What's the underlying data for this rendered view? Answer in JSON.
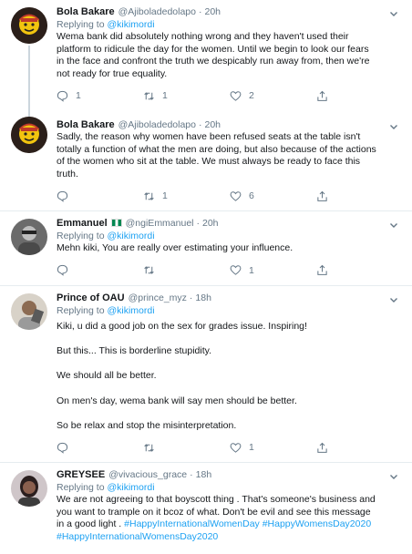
{
  "tweets": [
    {
      "name": "Bola Bakare",
      "handle": "@Ajiboladedolapo",
      "time": "20h",
      "reply_prefix": "Replying to",
      "reply_to": "@kikimordi",
      "lines": [
        "Wema bank did absolutely nothing wrong and they haven't used their",
        "platform to ridicule the day for the women. Until we begin to look our fears",
        "in the face and confront the truth we despicably run away from, then we're",
        "not ready for true equality."
      ],
      "replies": "1",
      "retweets": "1",
      "likes": "2"
    },
    {
      "name": "Bola Bakare",
      "handle": "@Ajiboladedolapo",
      "time": "20h",
      "lines": [
        "Sadly, the reason why women have been refused seats at the table isn't",
        "totally a function of what the men are doing, but also because of the actions",
        "of the women who sit at the table. We must always be ready to face this",
        "truth."
      ],
      "replies": "",
      "retweets": "1",
      "likes": "6"
    },
    {
      "name": "Emmanuel",
      "handle": "@ngiEmmanuel",
      "time": "20h",
      "reply_prefix": "Replying to",
      "reply_to": "@kikimordi",
      "lines": [
        "Mehn kiki, You are really over estimating your influence."
      ],
      "replies": "",
      "retweets": "",
      "likes": "1"
    },
    {
      "name": "Prince of OAU",
      "handle": "@prince_myz",
      "time": "18h",
      "reply_prefix": "Replying to",
      "reply_to": "@kikimordi",
      "paragraphs": [
        "Kiki, u did a good job on the sex for grades issue. Inspiring!",
        "But this... This is borderline stupidity.",
        "We should all be better.",
        "On men's day, wema bank will say men should be better.",
        "So be relax and stop the misinterpretation."
      ],
      "replies": "",
      "retweets": "",
      "likes": "1"
    },
    {
      "name": "GREYSEE",
      "handle": "@vivacious_grace",
      "time": "18h",
      "reply_prefix": "Replying to",
      "reply_to": "@kikimordi",
      "lines": [
        "We are not agreeing to that boyscott thing . That's someone's business and",
        "you want to trample on it bcoz of what.  Don't be evil and see this message",
        "in a good light . "
      ],
      "hashtags": [
        "#HappyInternationalWomenDay",
        "#HappyWomensDay2020",
        "#HappyInternationalWomensDay2020"
      ]
    }
  ],
  "separator": "·",
  "icons": {
    "reply": "reply-icon",
    "retweet": "retweet-icon",
    "like": "heart-icon",
    "share": "share-icon",
    "more": "chevron-down-icon"
  },
  "colors": {
    "link": "#1da1f2",
    "secondary": "#657786",
    "border": "#e6ecf0",
    "thread": "#ccd6dd"
  }
}
